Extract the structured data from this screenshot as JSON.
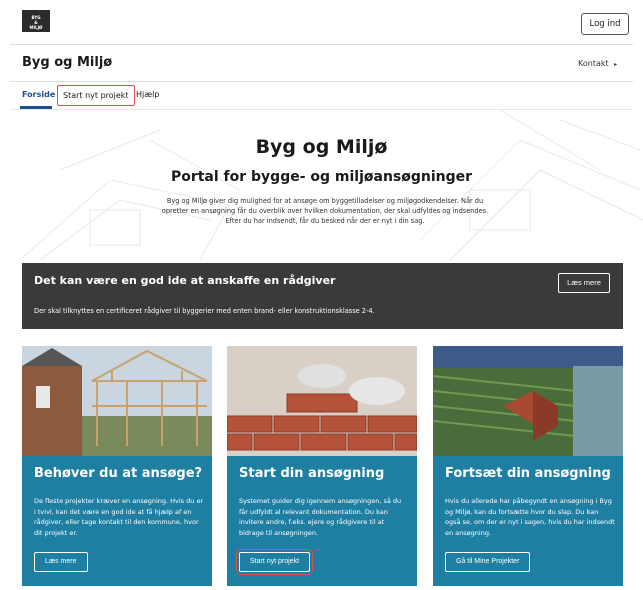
{
  "header": {
    "logo_lines": [
      "BYG",
      "&",
      "MILJØ"
    ],
    "login_label": "Log ind"
  },
  "site": {
    "title": "Byg og Miljø",
    "contact_label": "Kontakt",
    "contact_arrow": "▸"
  },
  "nav": {
    "items": [
      {
        "label": "Forside",
        "active": true
      },
      {
        "label": "Start nyt projekt",
        "highlighted": true
      },
      {
        "label": "Hjælp"
      }
    ]
  },
  "hero": {
    "title": "Byg og Miljø",
    "subtitle": "Portal for bygge- og miljøansøgninger",
    "text": "Byg og Miljø giver dig mulighed for at ansøge om byggetilladelser og miljøgodkendelser. Når du opretter en ansøgning får du overblik over hvilken dokumentation, der skal udfyldes og indsendes. Efter du har indsendt, får du besked når der er nyt i din sag."
  },
  "banner": {
    "title": "Det kan være en god ide at anskaffe en rådgiver",
    "text": "Der skal tilknyttes en certificeret rådgiver til byggerier med enten brand- eller konstruktionsklasse 2-4.",
    "button_label": "Læs mere"
  },
  "cards": [
    {
      "title": "Behøver du at ansøge?",
      "text": "De fleste projekter kræver en ansøgning. Hvis du er i tvivl, kan det være en god ide at få hjælp af en rådgiver, eller tage kontakt til den kommune, hvor dit projekt er.",
      "button_label": "Læs mere"
    },
    {
      "title": "Start din ansøgning",
      "text": "Systemet guider dig igennem ansøgningen, så du får udfyldt al relevant dokumentation. Du kan invitere andre, f.eks. ejere og rådgivere til at bidrage til ansøgningen.",
      "button_label": "Start nyt projekt"
    },
    {
      "title": "Fortsæt din ansøgning",
      "text": "Hvis du allerede har påbegyndt en ansøgning i Byg og Miljø, kan du fortsætte hvor du slap. Du kan også se, om der er nyt i sagen, hvis du har indsendt en ansøgning.",
      "button_label": "Gå til Mine Projekter"
    }
  ],
  "colors": {
    "accent": "#1c4f8c",
    "card_blue": "#1f7fa3",
    "banner_dark": "#3a3a3a",
    "highlight": "#d9534f"
  }
}
